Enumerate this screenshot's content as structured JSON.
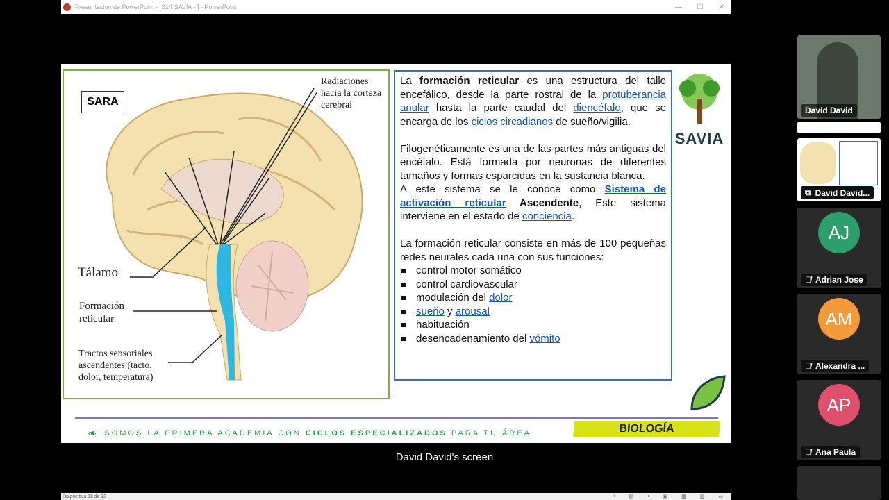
{
  "window": {
    "title": "Presentacion de PowerPoint - [S14 SAVIA - ] - PowerPoint"
  },
  "slide": {
    "badge": "SARA",
    "labels": {
      "radiaciones": "Radiaciones hacia la corteza cerebral",
      "talamo": "Tálamo",
      "formacion": "Formación reticular",
      "tractos": "Tractos sensoriales ascendentes (tacto, dolor, temperatura)"
    },
    "p1": {
      "a": "La ",
      "b": "formación reticular",
      "c": " es una estructura del tallo encefálico, desde la parte rostral de la ",
      "l1": "protuberancia anular",
      "d": " hasta la parte caudal del ",
      "l2": "diencéfalo",
      "e": ", que se encarga de los ",
      "l3": "ciclos circadianos",
      "f": " de sueño/vigilia."
    },
    "p2": "Filogenéticamente es una de las partes más antiguas del encéfalo. Está formada por neuronas de diferentes tamaños y formas esparcidas en la sustancia blanca.",
    "p3": {
      "a": "A este sistema se le conoce como ",
      "l1": "Sistema de activación reticular",
      "b": " Ascendente",
      "c": ", Este sistema interviene en el estado de ",
      "l2": "conciencia",
      "d": "."
    },
    "p4": "La formación reticular consiste en más de 100 pequeñas redes neurales cada una con sus funciones:",
    "list": {
      "i1": "control motor somático",
      "i2": "control cardiovascular",
      "i3a": "modulación del ",
      "i3l": "dolor",
      "i4l1": "sueño",
      "i4b": " y ",
      "i4l2": "arousal",
      "i5": "habituación",
      "i6a": "desencadenamiento del ",
      "i6l": "vómito"
    },
    "logo": "SAVIA",
    "footer": {
      "a": "SOMOS LA PRIMERA ACADEMIA CON ",
      "b": "CICLOS ESPECIALIZADOS",
      "c": " PARA TU ÁREA"
    },
    "subject": "BIOLOGÍA"
  },
  "caption": "David David's screen",
  "status": {
    "slide": "Diapositiva 11 de 32"
  },
  "participants": [
    {
      "name": "David David"
    },
    {
      "name": "David David..."
    },
    {
      "initials": "AJ",
      "name": "Adrian Jose",
      "color": "#2e9e6a"
    },
    {
      "initials": "AM",
      "name": "Alexandra ...",
      "color": "#f59a3a"
    },
    {
      "initials": "AP",
      "name": "Ana Paula",
      "color": "#e0506c"
    }
  ]
}
